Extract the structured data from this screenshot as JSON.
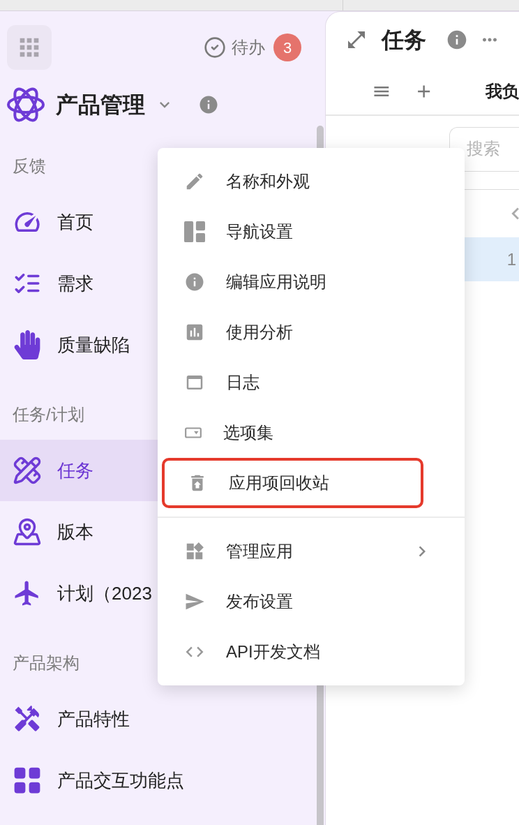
{
  "sidebar": {
    "todo": {
      "label": "待办",
      "count": "3"
    },
    "app": {
      "title": "产品管理"
    },
    "sections": [
      {
        "title": "反馈",
        "items": [
          {
            "label": "首页",
            "selected": false
          },
          {
            "label": "需求",
            "selected": false
          },
          {
            "label": "质量缺陷",
            "selected": false
          }
        ]
      },
      {
        "title": "任务/计划",
        "items": [
          {
            "label": "任务",
            "selected": true
          },
          {
            "label": "版本",
            "selected": false
          },
          {
            "label": "计划（2023",
            "selected": false
          }
        ]
      },
      {
        "title": "产品架构",
        "items": [
          {
            "label": "产品特性",
            "selected": false
          },
          {
            "label": "产品交互功能点",
            "selected": false
          }
        ]
      }
    ]
  },
  "panel": {
    "title": "任务",
    "toolbar": {
      "tab": "我负"
    },
    "filter": {
      "placeholder": "搜索"
    },
    "rows": [
      {
        "cell": "1",
        "selected": true
      }
    ]
  },
  "menu": {
    "groups": [
      [
        {
          "label": "名称和外观",
          "highlighted": false,
          "submenu": false
        },
        {
          "label": "导航设置",
          "highlighted": false,
          "submenu": false
        },
        {
          "label": "编辑应用说明",
          "highlighted": false,
          "submenu": false
        },
        {
          "label": "使用分析",
          "highlighted": false,
          "submenu": false
        },
        {
          "label": "日志",
          "highlighted": false,
          "submenu": false
        },
        {
          "label": "选项集",
          "highlighted": false,
          "submenu": false
        },
        {
          "label": "应用项回收站",
          "highlighted": true,
          "submenu": false
        }
      ],
      [
        {
          "label": "管理应用",
          "highlighted": false,
          "submenu": true
        },
        {
          "label": "发布设置",
          "highlighted": false,
          "submenu": false
        },
        {
          "label": "API开发文档",
          "highlighted": false,
          "submenu": false
        }
      ]
    ]
  }
}
